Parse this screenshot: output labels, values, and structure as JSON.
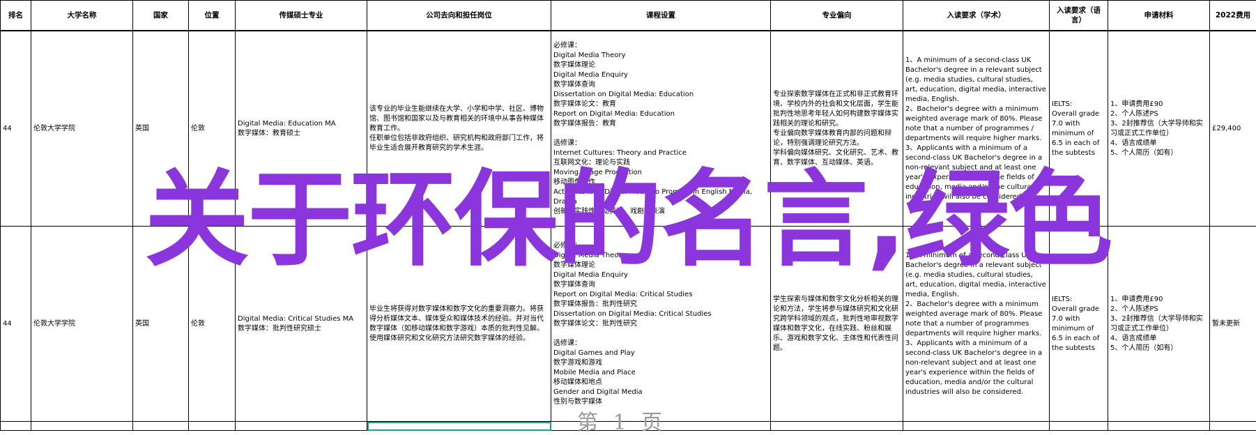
{
  "headers": [
    "排名",
    "大学名称",
    "国家",
    "位置",
    "传媒硕士专业",
    "公司去向和担任岗位",
    "课程设置",
    "专业偏向",
    "入读要求（学术）",
    "入读要求（语言）",
    "申请材料",
    "2022费用"
  ],
  "rows": [
    {
      "rank": "44",
      "university": "伦敦大学学院",
      "country": "英国",
      "city": "伦敦",
      "program": "Digital Media: Education MA\n数字媒体：教育硕士",
      "career": "该专业的毕业生能继续在大学、小学和中学、社区、博物馆、图书馆和国家以及与教育相关的环境中从事各种媒体教育工作。\n任职单位包括非政府组织、研究机构和政府部门工作，将毕业生适合展开教育研究的学术生涯。",
      "courses": "必修课：\nDigital Media Theory\n数字媒体理论\nDigital Media Enquiry\n数字媒体查询\nDissertation on Digital Media: Education\n数字媒体论文：教育\nReport on Digital Media: Education\n数字媒体报告：教育\n\n选修课：\nInternet Cultures: Theory and Practice\n互联网文化：理论与实践\nMoving Image Production\n移动图像制作\nActivities with Digital Media to Promote in English Media, Drama\n创新的实践性活动英语、戏剧等表演",
      "focus": "专业探索数字媒体在正式和非正式教育环境、学校内外的社会和文化层面，学生能批判性地思考年轻人如何构建数字媒体实践相关的理论和研究。\n专业偏向数字媒体教育内部的问题和辩论，特别强调理论研究方法。\n学科偏向媒体研究、文化研究、艺术、教育、数字媒体、互动媒体、英语。",
      "academic": "1、A minimum of a second-class UK Bachelor's degree in a relevant subject (e.g. media studies, cultural studies, art, education, digital media, interactive media, English.\n2、Bachelor's degree with a minimum weighted average mark of 80%. Please note that a number of programmes / departments will require higher marks.\n3、Applicants with a minimum of a second-class UK Bachelor's degree in a non-relevant subject and at least one year's experience within the fields of education, media and/or the cultural industries will also be considered.",
      "language": "IELTS:\nOverall grade 7.0 with minimum of 6.5 in each of the subtests",
      "materials": "1、申请费用£90\n2、个人陈述PS\n3、2封推荐信（大学导师和实习或正式工作单位）\n4、语言成绩单\n5、个人简历（如有）",
      "fee": "£29,400"
    },
    {
      "rank": "44",
      "university": "伦敦大学学院",
      "country": "英国",
      "city": "伦敦",
      "program": "Digital Media: Critical Studies MA\n数字媒体：批判性研究硕士",
      "career": "毕业生将获得对数字媒体和数字文化的重要洞察力。将获得分析媒体文本、媒体受众和媒体技术的经验。并对当代数字媒体（如移动媒体和数字游戏）本质的批判性见解。使用媒体研究和文化研究方法研究数字媒体的经验。",
      "courses": "必修课：\nDigital Media Theory\n数字媒体理论\nDigital Media Enquiry\n数字媒体查询\nReport on Digital Media: Critical Studies\n数字媒体报告：批判性研究\nDissertation on Digital Media: Critical Studies\n数字媒体论文：批判性研究\n\n选修课：\nDigital Games and Play\n数字游戏和游戏\nMobile Media and Place\n移动媒体和地点\nGender and Digital Media\n性别与数字媒体",
      "focus": "学生探索与媒体和数字文化分析相关的理论和方法，学生将参与媒体研究和文化研究跨学科领域的观点，批判性地审视数字媒体和数字文化，在线实践、粉丝和娱乐、游戏和数字文化、主体性和代表性问题。",
      "academic": "1、A minimum of a second-class UK Bachelor's degree in a relevant subject (e.g. media studies, cultural studies, art, education, digital media, interactive media, English.\n2、Bachelor's degree with a minimum weighted average mark of 80%. Please note that a number of programmes departments will require higher marks.\n3、Applicants with a minimum of a second-class UK Bachelor's degree in a non-relevant subject and at least one year's experience within the fields of education, media and/or the cultural industries will also be considered.",
      "language": "IELTS:\nOverall grade 7.0 with minimum of 6.5 in each of the subtests",
      "materials": "1、申请费用£90\n2、个人陈述PS\n3、2封推荐信（大学导师和实习或正式工作单位）\n4、语言成绩单\n5、个人简历（如有）",
      "fee": "暂未更新"
    }
  ],
  "overlay_text": "关于环保的名言,绿色",
  "overlay_color": "#8b35dc",
  "footer_ghost": "第 1 页"
}
